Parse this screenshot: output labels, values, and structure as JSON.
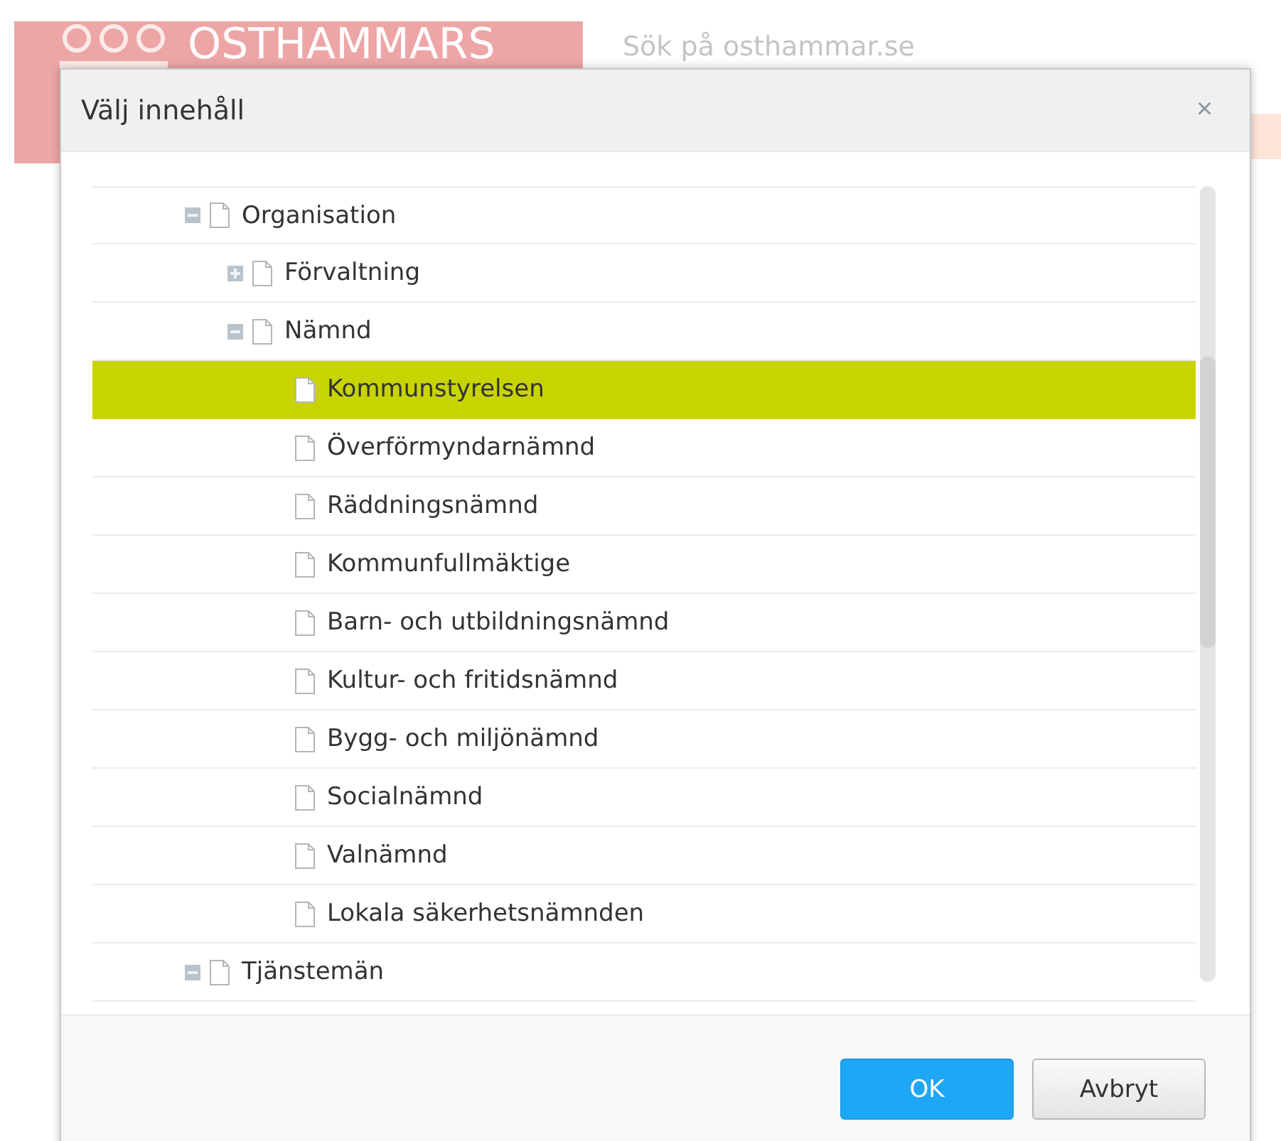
{
  "page": {
    "logo_text": "OSTHAMMARS",
    "search": {
      "placeholder": "Sök på osthammar.se"
    }
  },
  "dialog": {
    "title": "Välj innehåll",
    "close": "×",
    "tree": [
      {
        "label": "Organisation",
        "expanded": true,
        "selected": false,
        "children": [
          {
            "label": "Förvaltning",
            "expanded": false,
            "selected": false
          },
          {
            "label": "Nämnd",
            "expanded": true,
            "selected": false,
            "children": [
              {
                "label": "Kommunstyrelsen",
                "selected": true
              },
              {
                "label": "Överförmyndarnämnd",
                "selected": false
              },
              {
                "label": "Räddningsnämnd",
                "selected": false
              },
              {
                "label": "Kommunfullmäktige",
                "selected": false
              },
              {
                "label": "Barn- och utbildningsnämnd",
                "selected": false
              },
              {
                "label": "Kultur- och fritidsnämnd",
                "selected": false
              },
              {
                "label": "Bygg- och miljönämnd",
                "selected": false
              },
              {
                "label": "Socialnämnd",
                "selected": false
              },
              {
                "label": "Valnämnd",
                "selected": false
              },
              {
                "label": "Lokala säkerhetsnämnden",
                "selected": false
              }
            ]
          }
        ]
      },
      {
        "label": "Tjänstemän",
        "expanded": true,
        "selected": false
      }
    ],
    "buttons": [
      {
        "label": "OK",
        "kind": "primary"
      },
      {
        "label": "Avbryt",
        "kind": "secondary"
      }
    ]
  }
}
